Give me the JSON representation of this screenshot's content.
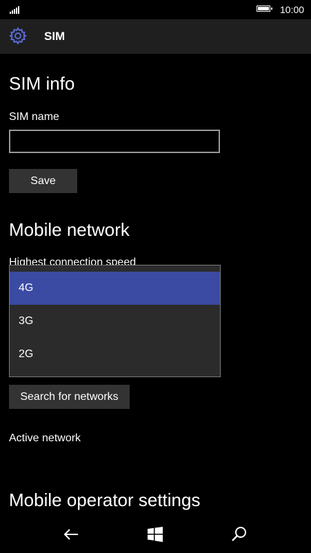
{
  "status": {
    "time": "10:00"
  },
  "header": {
    "title": "SIM"
  },
  "sim_info": {
    "heading": "SIM info",
    "name_label": "SIM name",
    "name_value": "",
    "save_label": "Save"
  },
  "mobile_network": {
    "heading": "Mobile network",
    "speed_label": "Highest connection speed",
    "speed_options": [
      "4G",
      "3G",
      "2G"
    ],
    "speed_selected": "4G",
    "search_label": "Search for networks",
    "active_label": "Active network"
  },
  "operator": {
    "heading": "Mobile operator settings"
  },
  "colors": {
    "accent": "#3b4aa3",
    "header_bg": "#1f1f1f",
    "dropdown_bg": "#2b2b2b",
    "button_bg": "#333333"
  },
  "icons": {
    "header": "gear-icon",
    "nav": [
      "back-arrow-icon",
      "windows-start-icon",
      "search-icon"
    ]
  }
}
